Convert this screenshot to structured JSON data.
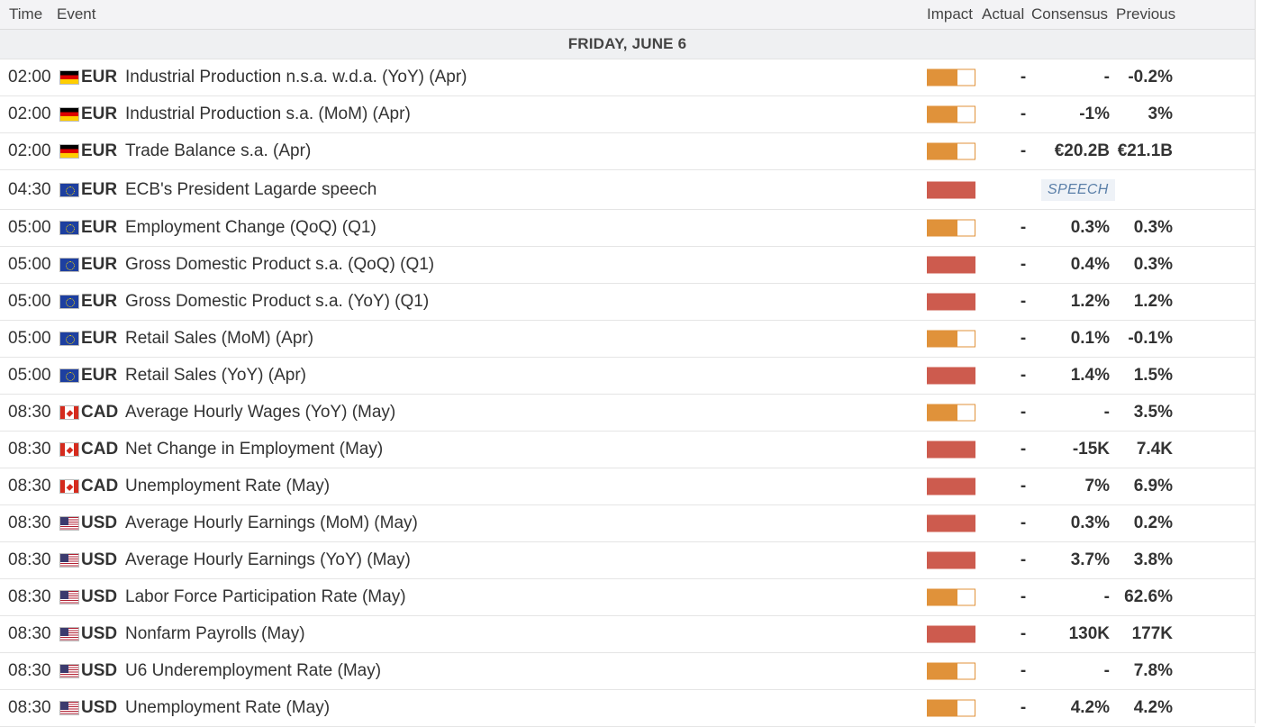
{
  "header": {
    "time": "Time",
    "event": "Event",
    "impact": "Impact",
    "actual": "Actual",
    "consensus": "Consensus",
    "previous": "Previous"
  },
  "day_label": "FRIDAY, JUNE 6",
  "colors": {
    "impact_medium": "#e0923a",
    "impact_high": "#cd5b4e",
    "speech_tag_text": "#5a7fa8"
  },
  "rows": [
    {
      "time": "02:00",
      "flag": "germany-flag-icon",
      "currency": "EUR",
      "event": "Industrial Production n.s.a. w.d.a. (YoY) (Apr)",
      "impact": "medium",
      "actual": "-",
      "consensus": "-",
      "previous": "-0.2%"
    },
    {
      "time": "02:00",
      "flag": "germany-flag-icon",
      "currency": "EUR",
      "event": "Industrial Production s.a. (MoM) (Apr)",
      "impact": "medium",
      "actual": "-",
      "consensus": "-1%",
      "previous": "3%"
    },
    {
      "time": "02:00",
      "flag": "germany-flag-icon",
      "currency": "EUR",
      "event": "Trade Balance s.a. (Apr)",
      "impact": "medium",
      "actual": "-",
      "consensus": "€20.2B",
      "previous": "€21.1B"
    },
    {
      "time": "04:30",
      "flag": "eu-flag-icon",
      "currency": "EUR",
      "event": "ECB's President Lagarde speech",
      "impact": "high",
      "tag": "SPEECH"
    },
    {
      "time": "05:00",
      "flag": "eu-flag-icon",
      "currency": "EUR",
      "event": "Employment Change (QoQ) (Q1)",
      "impact": "medium",
      "actual": "-",
      "consensus": "0.3%",
      "previous": "0.3%"
    },
    {
      "time": "05:00",
      "flag": "eu-flag-icon",
      "currency": "EUR",
      "event": "Gross Domestic Product s.a. (QoQ) (Q1)",
      "impact": "high",
      "actual": "-",
      "consensus": "0.4%",
      "previous": "0.3%"
    },
    {
      "time": "05:00",
      "flag": "eu-flag-icon",
      "currency": "EUR",
      "event": "Gross Domestic Product s.a. (YoY) (Q1)",
      "impact": "high",
      "actual": "-",
      "consensus": "1.2%",
      "previous": "1.2%"
    },
    {
      "time": "05:00",
      "flag": "eu-flag-icon",
      "currency": "EUR",
      "event": "Retail Sales (MoM) (Apr)",
      "impact": "medium",
      "actual": "-",
      "consensus": "0.1%",
      "previous": "-0.1%"
    },
    {
      "time": "05:00",
      "flag": "eu-flag-icon",
      "currency": "EUR",
      "event": "Retail Sales (YoY) (Apr)",
      "impact": "high",
      "actual": "-",
      "consensus": "1.4%",
      "previous": "1.5%"
    },
    {
      "time": "08:30",
      "flag": "canada-flag-icon",
      "currency": "CAD",
      "event": "Average Hourly Wages (YoY) (May)",
      "impact": "medium",
      "actual": "-",
      "consensus": "-",
      "previous": "3.5%"
    },
    {
      "time": "08:30",
      "flag": "canada-flag-icon",
      "currency": "CAD",
      "event": "Net Change in Employment (May)",
      "impact": "high",
      "actual": "-",
      "consensus": "-15K",
      "previous": "7.4K"
    },
    {
      "time": "08:30",
      "flag": "canada-flag-icon",
      "currency": "CAD",
      "event": "Unemployment Rate (May)",
      "impact": "high",
      "actual": "-",
      "consensus": "7%",
      "previous": "6.9%"
    },
    {
      "time": "08:30",
      "flag": "usa-flag-icon",
      "currency": "USD",
      "event": "Average Hourly Earnings (MoM) (May)",
      "impact": "high",
      "actual": "-",
      "consensus": "0.3%",
      "previous": "0.2%"
    },
    {
      "time": "08:30",
      "flag": "usa-flag-icon",
      "currency": "USD",
      "event": "Average Hourly Earnings (YoY) (May)",
      "impact": "high",
      "actual": "-",
      "consensus": "3.7%",
      "previous": "3.8%"
    },
    {
      "time": "08:30",
      "flag": "usa-flag-icon",
      "currency": "USD",
      "event": "Labor Force Participation Rate (May)",
      "impact": "medium",
      "actual": "-",
      "consensus": "-",
      "previous": "62.6%"
    },
    {
      "time": "08:30",
      "flag": "usa-flag-icon",
      "currency": "USD",
      "event": "Nonfarm Payrolls (May)",
      "impact": "high",
      "actual": "-",
      "consensus": "130K",
      "previous": "177K"
    },
    {
      "time": "08:30",
      "flag": "usa-flag-icon",
      "currency": "USD",
      "event": "U6 Underemployment Rate (May)",
      "impact": "medium",
      "actual": "-",
      "consensus": "-",
      "previous": "7.8%"
    },
    {
      "time": "08:30",
      "flag": "usa-flag-icon",
      "currency": "USD",
      "event": "Unemployment Rate (May)",
      "impact": "medium",
      "actual": "-",
      "consensus": "4.2%",
      "previous": "4.2%"
    }
  ]
}
